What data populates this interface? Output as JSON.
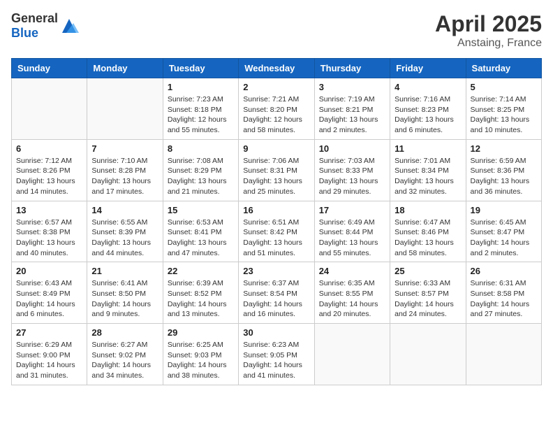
{
  "header": {
    "logo_general": "General",
    "logo_blue": "Blue",
    "month_year": "April 2025",
    "location": "Anstaing, France"
  },
  "days_of_week": [
    "Sunday",
    "Monday",
    "Tuesday",
    "Wednesday",
    "Thursday",
    "Friday",
    "Saturday"
  ],
  "weeks": [
    [
      {
        "day": "",
        "info": ""
      },
      {
        "day": "",
        "info": ""
      },
      {
        "day": "1",
        "info": "Sunrise: 7:23 AM\nSunset: 8:18 PM\nDaylight: 12 hours and 55 minutes."
      },
      {
        "day": "2",
        "info": "Sunrise: 7:21 AM\nSunset: 8:20 PM\nDaylight: 12 hours and 58 minutes."
      },
      {
        "day": "3",
        "info": "Sunrise: 7:19 AM\nSunset: 8:21 PM\nDaylight: 13 hours and 2 minutes."
      },
      {
        "day": "4",
        "info": "Sunrise: 7:16 AM\nSunset: 8:23 PM\nDaylight: 13 hours and 6 minutes."
      },
      {
        "day": "5",
        "info": "Sunrise: 7:14 AM\nSunset: 8:25 PM\nDaylight: 13 hours and 10 minutes."
      }
    ],
    [
      {
        "day": "6",
        "info": "Sunrise: 7:12 AM\nSunset: 8:26 PM\nDaylight: 13 hours and 14 minutes."
      },
      {
        "day": "7",
        "info": "Sunrise: 7:10 AM\nSunset: 8:28 PM\nDaylight: 13 hours and 17 minutes."
      },
      {
        "day": "8",
        "info": "Sunrise: 7:08 AM\nSunset: 8:29 PM\nDaylight: 13 hours and 21 minutes."
      },
      {
        "day": "9",
        "info": "Sunrise: 7:06 AM\nSunset: 8:31 PM\nDaylight: 13 hours and 25 minutes."
      },
      {
        "day": "10",
        "info": "Sunrise: 7:03 AM\nSunset: 8:33 PM\nDaylight: 13 hours and 29 minutes."
      },
      {
        "day": "11",
        "info": "Sunrise: 7:01 AM\nSunset: 8:34 PM\nDaylight: 13 hours and 32 minutes."
      },
      {
        "day": "12",
        "info": "Sunrise: 6:59 AM\nSunset: 8:36 PM\nDaylight: 13 hours and 36 minutes."
      }
    ],
    [
      {
        "day": "13",
        "info": "Sunrise: 6:57 AM\nSunset: 8:38 PM\nDaylight: 13 hours and 40 minutes."
      },
      {
        "day": "14",
        "info": "Sunrise: 6:55 AM\nSunset: 8:39 PM\nDaylight: 13 hours and 44 minutes."
      },
      {
        "day": "15",
        "info": "Sunrise: 6:53 AM\nSunset: 8:41 PM\nDaylight: 13 hours and 47 minutes."
      },
      {
        "day": "16",
        "info": "Sunrise: 6:51 AM\nSunset: 8:42 PM\nDaylight: 13 hours and 51 minutes."
      },
      {
        "day": "17",
        "info": "Sunrise: 6:49 AM\nSunset: 8:44 PM\nDaylight: 13 hours and 55 minutes."
      },
      {
        "day": "18",
        "info": "Sunrise: 6:47 AM\nSunset: 8:46 PM\nDaylight: 13 hours and 58 minutes."
      },
      {
        "day": "19",
        "info": "Sunrise: 6:45 AM\nSunset: 8:47 PM\nDaylight: 14 hours and 2 minutes."
      }
    ],
    [
      {
        "day": "20",
        "info": "Sunrise: 6:43 AM\nSunset: 8:49 PM\nDaylight: 14 hours and 6 minutes."
      },
      {
        "day": "21",
        "info": "Sunrise: 6:41 AM\nSunset: 8:50 PM\nDaylight: 14 hours and 9 minutes."
      },
      {
        "day": "22",
        "info": "Sunrise: 6:39 AM\nSunset: 8:52 PM\nDaylight: 14 hours and 13 minutes."
      },
      {
        "day": "23",
        "info": "Sunrise: 6:37 AM\nSunset: 8:54 PM\nDaylight: 14 hours and 16 minutes."
      },
      {
        "day": "24",
        "info": "Sunrise: 6:35 AM\nSunset: 8:55 PM\nDaylight: 14 hours and 20 minutes."
      },
      {
        "day": "25",
        "info": "Sunrise: 6:33 AM\nSunset: 8:57 PM\nDaylight: 14 hours and 24 minutes."
      },
      {
        "day": "26",
        "info": "Sunrise: 6:31 AM\nSunset: 8:58 PM\nDaylight: 14 hours and 27 minutes."
      }
    ],
    [
      {
        "day": "27",
        "info": "Sunrise: 6:29 AM\nSunset: 9:00 PM\nDaylight: 14 hours and 31 minutes."
      },
      {
        "day": "28",
        "info": "Sunrise: 6:27 AM\nSunset: 9:02 PM\nDaylight: 14 hours and 34 minutes."
      },
      {
        "day": "29",
        "info": "Sunrise: 6:25 AM\nSunset: 9:03 PM\nDaylight: 14 hours and 38 minutes."
      },
      {
        "day": "30",
        "info": "Sunrise: 6:23 AM\nSunset: 9:05 PM\nDaylight: 14 hours and 41 minutes."
      },
      {
        "day": "",
        "info": ""
      },
      {
        "day": "",
        "info": ""
      },
      {
        "day": "",
        "info": ""
      }
    ]
  ]
}
